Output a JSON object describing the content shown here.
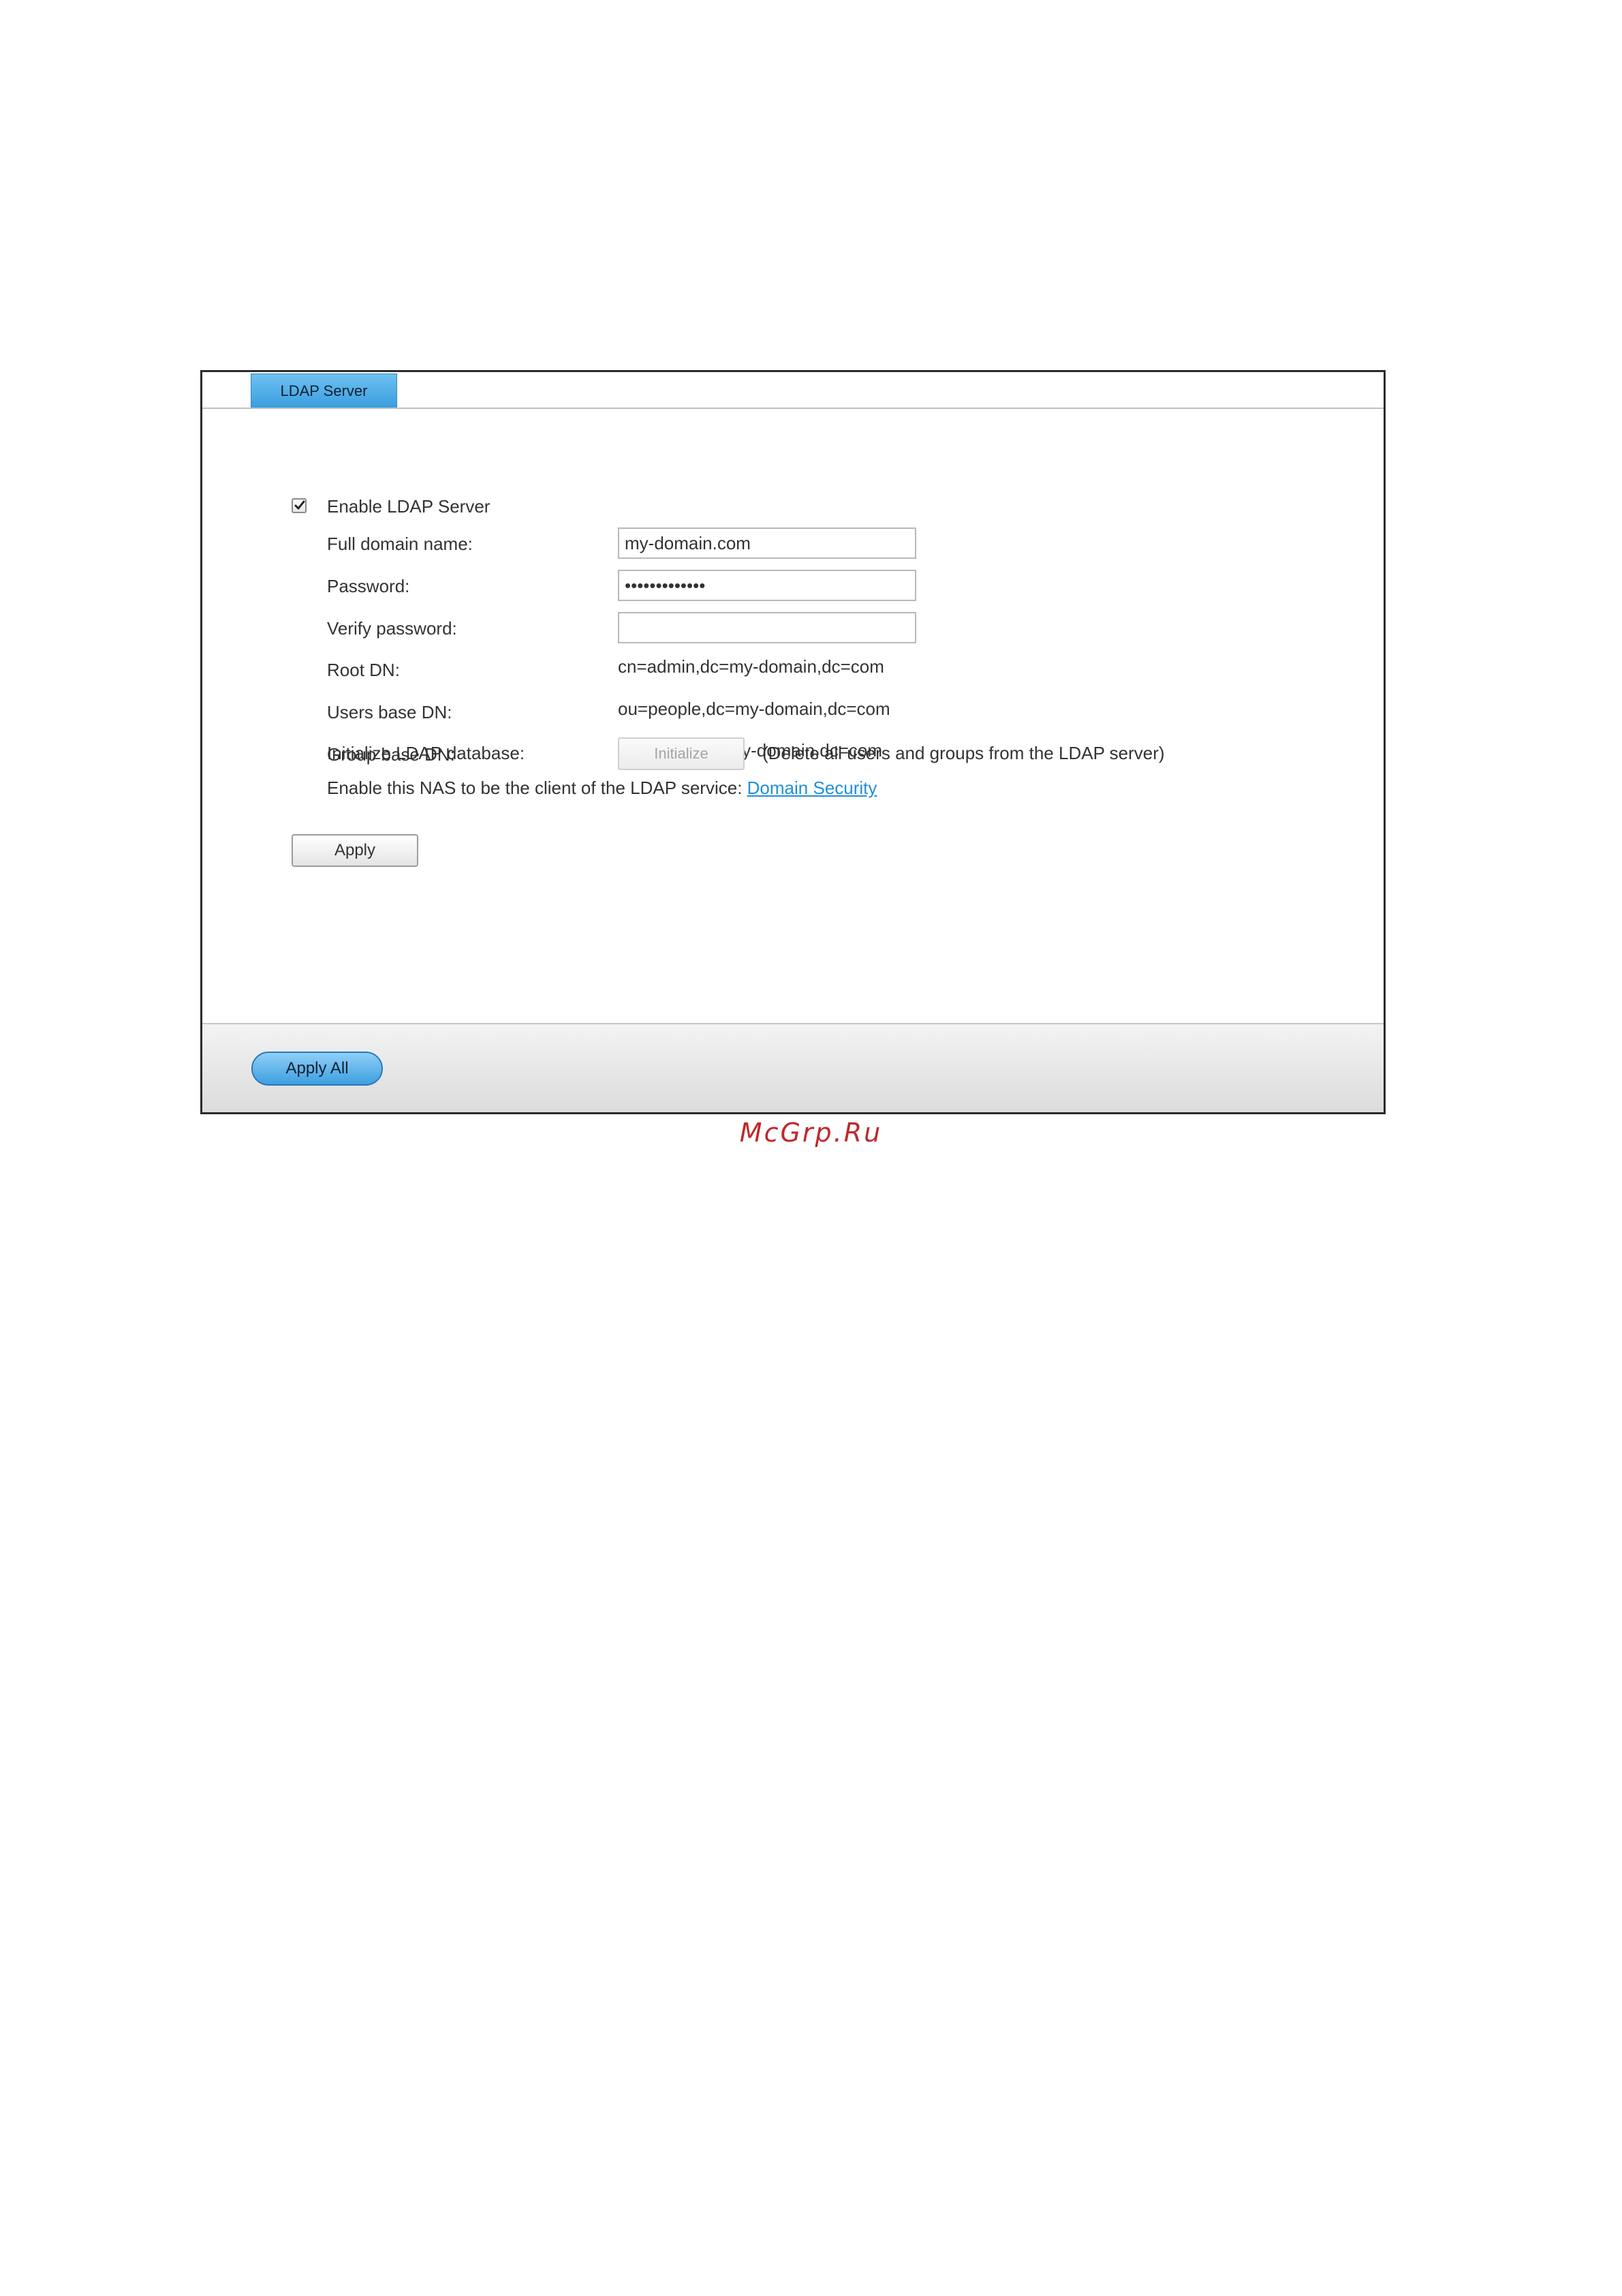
{
  "tab": {
    "label": "LDAP Server"
  },
  "form": {
    "enable_label": "Enable LDAP Server",
    "enable_checked": true,
    "fields": {
      "domain_label": "Full domain name:",
      "domain_value": "my-domain.com",
      "password_label": "Password:",
      "password_value": "•••••••••••••",
      "verify_label": "Verify password:",
      "verify_value": "",
      "root_dn_label": "Root DN:",
      "root_dn_value": "cn=admin,dc=my-domain,dc=com",
      "users_dn_label": "Users base DN:",
      "users_dn_value": "ou=people,dc=my-domain,dc=com",
      "group_dn_label": "Group base DN:",
      "group_dn_value": "ou=group,dc=my-domain,dc=com",
      "init_label": "Initialize LDAP database:",
      "init_button": "Initialize",
      "init_note": "(Delete all users and groups from the LDAP server)"
    },
    "client_text": "Enable this NAS to be the client of the LDAP service:",
    "client_link": "Domain Security",
    "apply_button": "Apply"
  },
  "footer": {
    "apply_all_button": "Apply All"
  },
  "watermark": "McGrp.Ru"
}
